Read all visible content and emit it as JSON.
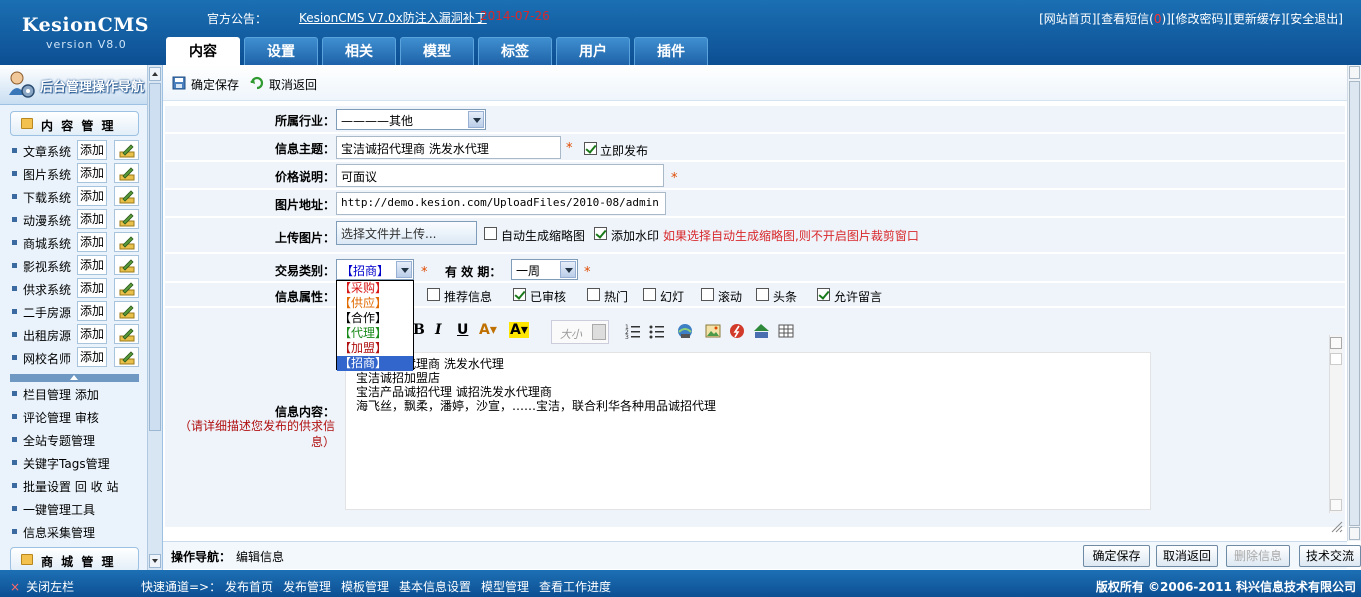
{
  "header": {
    "logo": "KesionCMS",
    "version": "version V8.0",
    "announce_label": "官方公告：",
    "announce_link": "KesionCMS V7.0x防注入漏洞补丁",
    "announce_date": "2014-07-26",
    "links": [
      "[网站首页]",
      "[查看短信(",
      "0",
      ")]",
      "[修改密码]",
      "[更新缓存]",
      "[安全退出]"
    ],
    "tabs": [
      "内容",
      "设置",
      "相关",
      "模型",
      "标签",
      "用户",
      "插件"
    ]
  },
  "sidebar": {
    "title": "后台管理操作导航",
    "section1": "内 容 管 理",
    "items": [
      {
        "label": "文章系统",
        "add": "添加"
      },
      {
        "label": "图片系统",
        "add": "添加"
      },
      {
        "label": "下载系统",
        "add": "添加"
      },
      {
        "label": "动漫系统",
        "add": "添加"
      },
      {
        "label": "商城系统",
        "add": "添加"
      },
      {
        "label": "影视系统",
        "add": "添加"
      },
      {
        "label": "供求系统",
        "add": "添加"
      },
      {
        "label": "二手房源",
        "add": "添加"
      },
      {
        "label": "出租房源",
        "add": "添加"
      },
      {
        "label": "网校名师",
        "add": "添加"
      }
    ],
    "links": [
      "栏目管理 添加",
      "评论管理 审核",
      "全站专题管理",
      "关键字Tags管理",
      "批量设置 回 收 站",
      "一键管理工具",
      "信息采集管理"
    ],
    "section2": "商 城 管 理"
  },
  "toolbar": {
    "save": "确定保存",
    "cancel": "取消返回"
  },
  "form": {
    "industry_label": "所属行业：",
    "industry_value": "————其他",
    "subject_label": "信息主题：",
    "subject_value": "宝洁诚招代理商 洗发水代理",
    "publish_now": "立即发布",
    "price_label": "价格说明：",
    "price_value": "可面议",
    "image_label": "图片地址：",
    "image_value": "http://demo.kesion.com/UploadFiles/2010-08/admin",
    "upload_label": "上传图片：",
    "upload_button": "选择文件并上传...",
    "auto_thumb": "自动生成缩略图",
    "watermark": "添加水印",
    "upload_note": "如果选择自动生成缩略图,则不开启图片裁剪窗口",
    "trade_label": "交易类别：",
    "trade_value": "【招商】",
    "trade_options": [
      "【采购】",
      "【供应】",
      "【合作】",
      "【代理】",
      "【加盟】",
      "【招商】"
    ],
    "valid_label": "有 效 期：",
    "valid_value": "一周",
    "attr_label": "信息属性：",
    "attrs": [
      {
        "label": "推荐信息",
        "checked": false
      },
      {
        "label": "已审核",
        "checked": true
      },
      {
        "label": "热门",
        "checked": false
      },
      {
        "label": "幻灯",
        "checked": false
      },
      {
        "label": "滚动",
        "checked": false
      },
      {
        "label": "头条",
        "checked": false
      },
      {
        "label": "允许留言",
        "checked": true
      }
    ],
    "content_label": "信息内容：",
    "content_hint": "（请详细描述您发布的供求信息）",
    "font_size": "大小",
    "content_lines": [
      "宝洁诚招代理商 洗发水代理",
      "宝洁诚招加盟店",
      "宝洁产品诚招代理 诚招洗发水代理商",
      "海飞丝，飘柔，潘婷，沙宣，……宝洁，联合利华各种用品诚招代理"
    ]
  },
  "bottom": {
    "nav_label": "操作导航：",
    "nav_value": "编辑信息",
    "buttons": [
      "确定保存",
      "取消返回",
      "删除信息",
      "技术交流"
    ]
  },
  "footer": {
    "close_left": "关闭左栏",
    "quick_label": "快速通道=>：",
    "quick_links": [
      "发布首页",
      "发布管理",
      "模板管理",
      "基本信息设置",
      "模型管理",
      "查看工作进度"
    ],
    "copyright": "版权所有 ©2006-2011 科兴信息技术有限公司"
  },
  "colors": {
    "header_blue": "#1b6fb3",
    "required": "#e04a00",
    "note_red": "#d8282b"
  }
}
